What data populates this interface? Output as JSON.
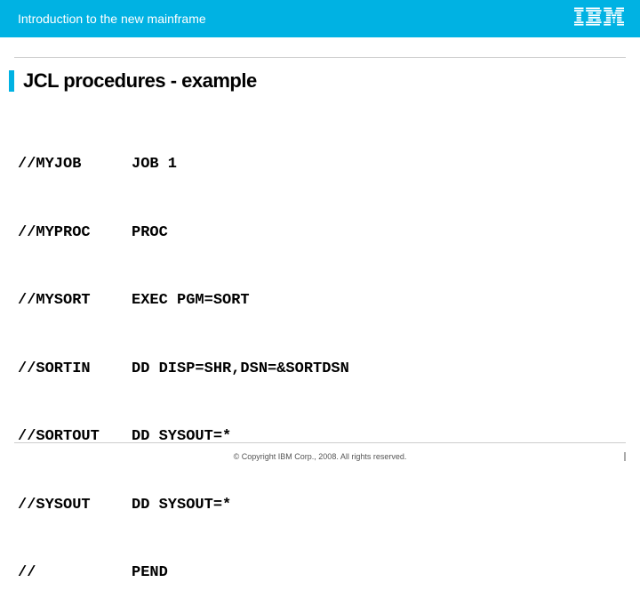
{
  "header": {
    "title": "Introduction to the new mainframe",
    "logo_name": "ibm-logo"
  },
  "slide": {
    "title": "JCL procedures - example",
    "code": [
      {
        "label": "//MYJOB",
        "value": "JOB 1"
      },
      {
        "label": "//MYPROC",
        "value": "PROC"
      },
      {
        "label": "//MYSORT",
        "value": "EXEC PGM=SORT"
      },
      {
        "label": "//SORTIN",
        "value": "DD DISP=SHR,DSN=&SORTDSN"
      },
      {
        "label": "//SORTOUT",
        "value": "DD SYSOUT=*"
      },
      {
        "label": "//SYSOUT",
        "value": "DD SYSOUT=*"
      },
      {
        "label": "//",
        "value": "PEND"
      }
    ]
  },
  "footer": {
    "copyright": "© Copyright IBM Corp., 2008. All rights reserved."
  }
}
